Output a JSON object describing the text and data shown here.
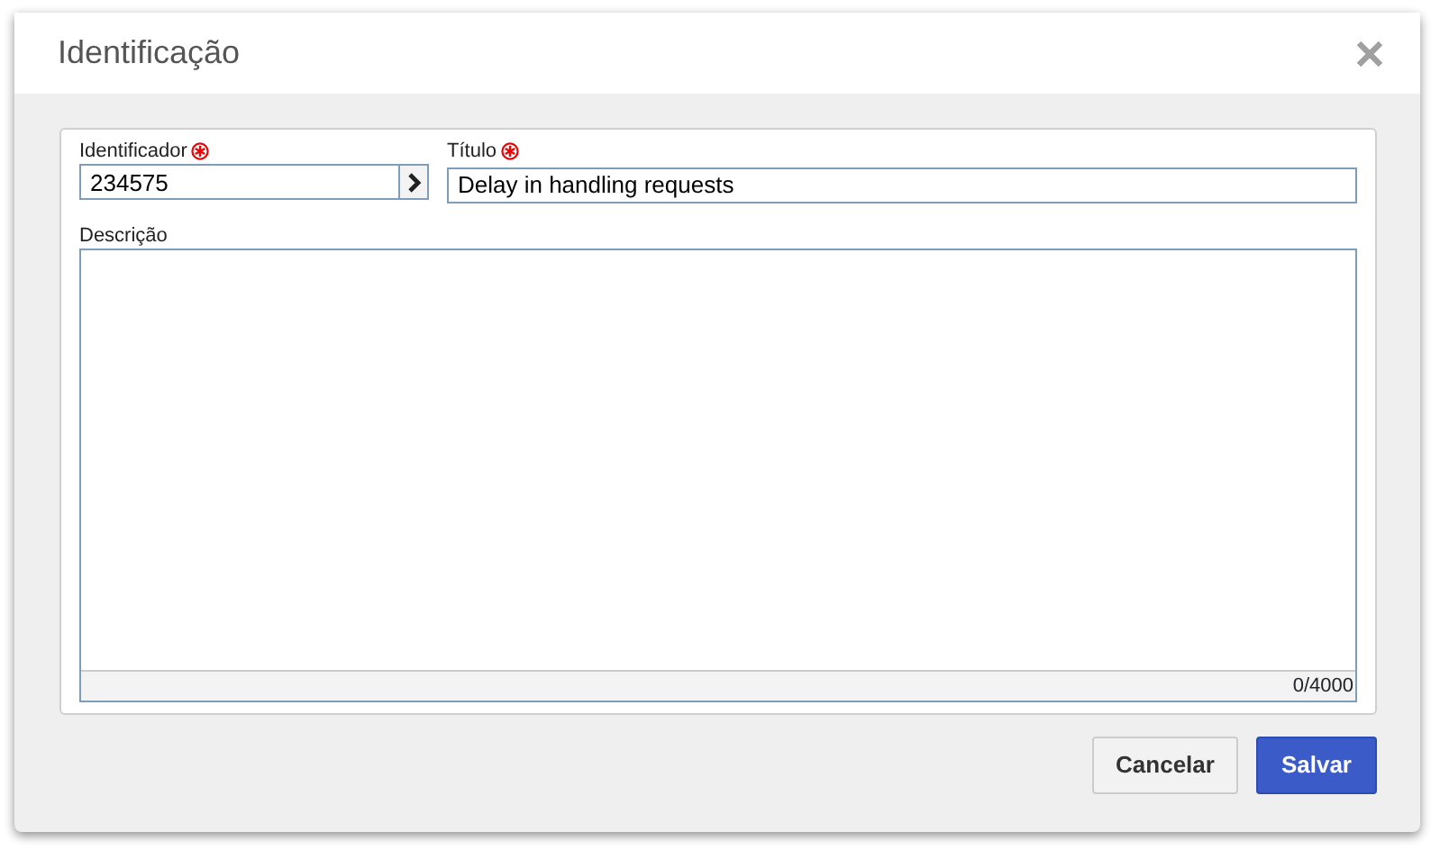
{
  "dialog": {
    "title": "Identificação"
  },
  "fields": {
    "identifier": {
      "label": "Identificador",
      "required": true,
      "value": "234575"
    },
    "title": {
      "label": "Título",
      "required": true,
      "value": "Delay in handling requests"
    },
    "description": {
      "label": "Descrição",
      "counter": "0/4000"
    }
  },
  "buttons": [
    {
      "label": "Cancelar",
      "kind": "secondary"
    },
    {
      "label": "Salvar",
      "kind": "primary"
    }
  ]
}
